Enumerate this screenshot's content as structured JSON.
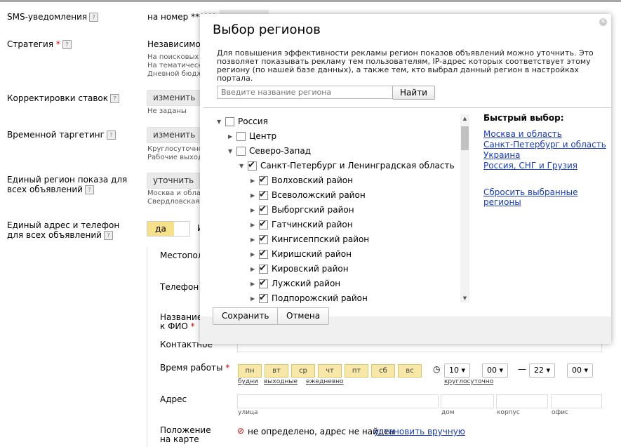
{
  "form": {
    "sms_label": "SMS-уведомления",
    "sms_value": "на номер ******",
    "strategy_label": "Стратегия",
    "strategy_value": "Независимое у",
    "strategy_notes": [
      "На поисковых",
      "На тематическ",
      "Дневной бюдж"
    ],
    "bid_adjust_label": "Корректировки ставок",
    "bid_adjust_button": "изменить",
    "bid_adjust_note": "Не заданы",
    "time_target_label": "Временной таргетинг",
    "time_target_button": "изменить",
    "time_target_notes": [
      "Круглосуточно",
      "Рабочие выход"
    ],
    "region_label": "Единый регион показа для всех объявлений",
    "region_button": "уточнить",
    "region_notes": [
      "Москва и обла",
      "Свердловская"
    ],
    "address_label": "Единый адрес и телефон для всех объявлений",
    "address_toggle": "да",
    "address_toggle_tail": "И",
    "location_label": "Местопол",
    "phone_label": "Телефон",
    "company_label": "Название к ФИО",
    "contact_label": "Контактное",
    "hours_label": "Время работы",
    "days": [
      "пн",
      "вт",
      "ср",
      "чт",
      "пт",
      "сб",
      "вс"
    ],
    "day_links": [
      "будни",
      "выходные",
      "ежедневно"
    ],
    "time_from_h": "10",
    "time_from_m": "00",
    "time_dash": "—",
    "time_to_h": "22",
    "time_to_m": "00",
    "around_clock": "круглосуточно",
    "address_field_label": "Адрес",
    "address_captions": [
      "улица",
      "дом",
      "корпус",
      "офис"
    ],
    "map_label": "Положение на карте",
    "map_status": "не определено, адрес не найден",
    "map_link": "установить вручную"
  },
  "modal": {
    "title": "Выбор регионов",
    "description": "Для повышения эффективности рекламы регион показов объявлений можно уточнить. Это позволяет показывать рекламу тем пользователям, IP-адрес которых соответствует этому региону (по нашей базе данных), а также тем, кто выбрал данный регион в настройках портала.",
    "search_placeholder": "Введите название региона",
    "search_button": "Найти",
    "tree": [
      {
        "label": "Россия",
        "checked": false,
        "expanded": true,
        "level": 0
      },
      {
        "label": "Центр",
        "checked": false,
        "expanded": false,
        "level": 1
      },
      {
        "label": "Северо-Запад",
        "checked": false,
        "expanded": true,
        "level": 1
      },
      {
        "label": "Санкт-Петербург и Ленинградская область",
        "checked": true,
        "expanded": true,
        "level": 2
      },
      {
        "label": "Волховский район",
        "checked": true,
        "expanded": false,
        "level": 3
      },
      {
        "label": "Всеволожский район",
        "checked": true,
        "expanded": false,
        "level": 3
      },
      {
        "label": "Выборгский район",
        "checked": true,
        "expanded": false,
        "level": 3
      },
      {
        "label": "Гатчинский район",
        "checked": true,
        "expanded": false,
        "level": 3
      },
      {
        "label": "Кингисеппский район",
        "checked": true,
        "expanded": false,
        "level": 3
      },
      {
        "label": "Киришский район",
        "checked": true,
        "expanded": false,
        "level": 3
      },
      {
        "label": "Кировский район",
        "checked": true,
        "expanded": false,
        "level": 3
      },
      {
        "label": "Лужский район",
        "checked": true,
        "expanded": false,
        "level": 3
      },
      {
        "label": "Подпорожский район",
        "checked": true,
        "expanded": false,
        "level": 3
      }
    ],
    "quick_title": "Быстрый выбор:",
    "quick_links": [
      "Москва и область",
      "Санкт-Петербург и область",
      "Украина",
      "Россия, СНГ и Грузия"
    ],
    "reset_link": "Сбросить выбранные регионы",
    "save_button": "Сохранить",
    "cancel_button": "Отмена"
  },
  "colors": {
    "link": "#1a3dc1",
    "overlay": "#000000",
    "required": "#dd0000",
    "day_bg": "#f7e8a8"
  }
}
